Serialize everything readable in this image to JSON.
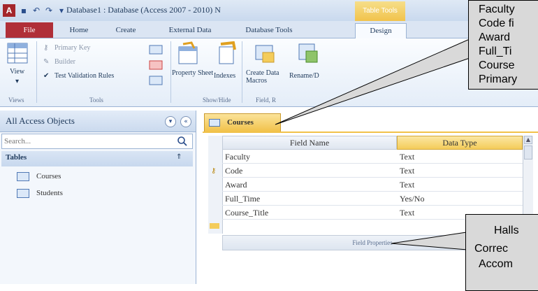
{
  "window": {
    "title": "Database1 : Database (Access 2007 - 2010) N",
    "app_icon": "A",
    "context_tools": "Table Tools",
    "qa_icons": [
      "save-icon",
      "undo-icon",
      "redo-icon",
      "customize-icon"
    ]
  },
  "tabs": [
    {
      "label": "File"
    },
    {
      "label": "Home"
    },
    {
      "label": "Create"
    },
    {
      "label": "External Data"
    },
    {
      "label": "Database Tools"
    },
    {
      "label": "Design"
    }
  ],
  "ribbon": {
    "view_label": "View",
    "primary_key": "Primary Key",
    "builder": "Builder",
    "test_validation": "Test Validation Rules",
    "property_sheet": "Property Sheet",
    "indexes": "Indexes",
    "create_data_macros": "Create Data Macros",
    "rename_macro": "Rename/D",
    "groups": {
      "views": "Views",
      "tools": "Tools",
      "show_hide": "Show/Hide",
      "field_events": "Field, R"
    }
  },
  "nav": {
    "title": "All Access Objects",
    "search_placeholder": "Search...",
    "section": "Tables",
    "items": [
      {
        "label": "Courses"
      },
      {
        "label": "Students"
      }
    ]
  },
  "document": {
    "tab_label": "Courses",
    "headers": {
      "field_name": "Field Name",
      "data_type": "Data Type"
    },
    "rows": [
      {
        "field": "Faculty",
        "type": "Text",
        "key": false
      },
      {
        "field": "Code",
        "type": "Text",
        "key": true
      },
      {
        "field": "Award",
        "type": "Text",
        "key": false
      },
      {
        "field": "Full_Time",
        "type": "Yes/No",
        "key": false
      },
      {
        "field": "Course_Title",
        "type": "Text",
        "key": false
      }
    ],
    "field_properties": "Field Properties"
  },
  "callouts": {
    "first": [
      "Faculty",
      "Code fi",
      "Award",
      "Full_Ti",
      "Course",
      "Primary"
    ],
    "second": [
      "Halls",
      "Correc",
      "Accom"
    ]
  },
  "colors": {
    "file_tab": "#b02f38",
    "accent_gold": "#f4cc5a",
    "ribbon_blue": "#dbe5f3",
    "callout_gray": "#d9d9d9"
  }
}
